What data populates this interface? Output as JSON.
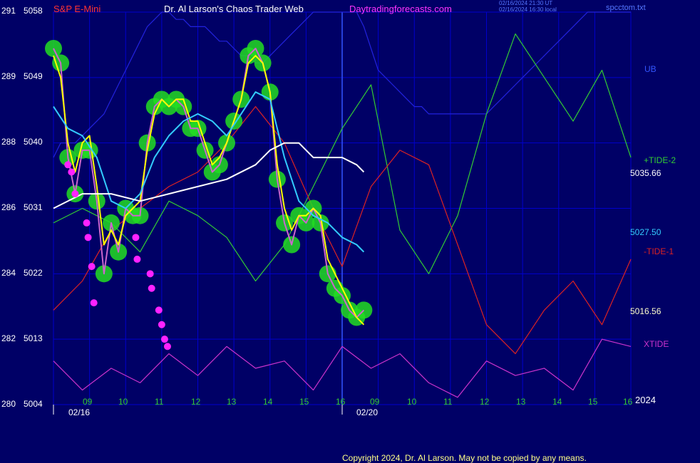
{
  "header": {
    "instrument": "S&P E-Mini",
    "site_title": "Dr. Al Larson's Chaos Trader Web",
    "site_url": "Daytradingforecasts.com",
    "timestamp_line1": "02/16/2024 21:30 UT",
    "timestamp_line2": "02/16/2024 16:30 local",
    "filename": "spcctom.txt"
  },
  "right_labels": {
    "ub": "UB",
    "tide2": "+TIDE-2",
    "value_upper": "5035.66",
    "value_mid": "5027.50",
    "tide1": "-TIDE-1",
    "value_lower": "5016.56",
    "xtide": "XTIDE",
    "year": "2024"
  },
  "footer": {
    "copyright": "Copyright 2024, Dr. Al Larson. May not be copied by any means."
  },
  "colors": {
    "background": "#000066",
    "grid": "#0000cc",
    "axis_text": "#ffffff",
    "price": "#cc66cc",
    "fast_avg": "#ffff00",
    "mid_avg": "#33ccff",
    "slow_avg": "#ffffff",
    "tide_green": "#33cc33",
    "tide_red": "#dd2222",
    "band_blue": "#2222dd",
    "xtide": "#cc33cc",
    "glow": "#22dd22",
    "marker": "#ff22ff"
  },
  "chart_data": {
    "type": "line",
    "title": "S&P E-Mini",
    "y_axis_left_ticks": [
      "291",
      "289",
      "288",
      "286",
      "284",
      "282",
      "280"
    ],
    "y_axis_price_ticks": [
      "5058",
      "5049",
      "5040",
      "5031",
      "5022",
      "5013",
      "5004"
    ],
    "ylim": [
      5004,
      5058
    ],
    "x_tick_labels": [
      "09",
      "10",
      "11",
      "12",
      "13",
      "14",
      "15",
      "16",
      "09",
      "10",
      "11",
      "12",
      "13",
      "14",
      "15",
      "16"
    ],
    "date_labels": [
      "02/16",
      "02/20"
    ],
    "series": [
      {
        "name": "UB",
        "color": "#2222dd",
        "x": [
          0,
          1,
          2,
          3,
          4,
          5,
          6,
          7,
          8,
          9,
          10,
          11,
          12,
          13,
          14,
          15,
          16,
          17,
          18,
          19,
          20,
          21,
          22,
          23,
          24,
          25,
          26,
          27,
          28,
          29,
          30,
          31,
          32,
          33,
          34,
          35,
          36,
          37,
          38,
          39,
          40,
          41,
          42,
          43,
          44,
          45,
          46,
          47,
          48,
          49,
          50,
          51,
          52,
          53,
          54,
          55,
          56,
          57,
          58,
          59,
          60,
          61,
          62,
          63,
          64,
          65,
          66,
          67,
          68,
          69,
          70,
          71,
          72,
          73,
          74,
          75,
          76,
          77,
          78,
          79,
          80
        ],
        "values": [
          5038,
          5040,
          5040,
          5040,
          5041,
          5042,
          5043,
          5044,
          5046,
          5048,
          5050,
          5052,
          5054,
          5056,
          5057,
          5058,
          5058,
          5057,
          5057,
          5056,
          5056,
          5056,
          5055,
          5054,
          5054,
          5053,
          5052,
          5052,
          5051,
          5051,
          5052,
          5053,
          5054,
          5055,
          5056,
          5057,
          5058,
          5058,
          5058,
          5058,
          5058,
          5058,
          5058,
          5056,
          5053,
          5050,
          5049,
          5048,
          5047,
          5046,
          5045,
          5045,
          5044,
          5044,
          5044,
          5044,
          5044,
          5044,
          5044,
          5044,
          5044,
          5045,
          5046,
          5047,
          5048,
          5049,
          5050,
          5051,
          5052,
          5053,
          5054,
          5055,
          5056,
          5057,
          5058,
          5058,
          5058,
          5058,
          5058,
          5058,
          5058
        ]
      },
      {
        "name": "+TIDE-2",
        "color": "#33cc33",
        "x": [
          0,
          4,
          8,
          12,
          16,
          20,
          24,
          28,
          32,
          36,
          40,
          44,
          48,
          52,
          56,
          60,
          64,
          68,
          72,
          76,
          80
        ],
        "values": [
          5029,
          5031,
          5029,
          5025,
          5032,
          5030,
          5027,
          5021,
          5026,
          5034,
          5042,
          5048,
          5028,
          5022,
          5030,
          5044,
          5055,
          5049,
          5043,
          5050,
          5038
        ]
      },
      {
        "name": "-TIDE-1",
        "color": "#dd2222",
        "x": [
          0,
          4,
          8,
          12,
          16,
          20,
          24,
          28,
          32,
          36,
          40,
          44,
          48,
          52,
          56,
          60,
          64,
          68,
          72,
          76,
          80
        ],
        "values": [
          5017,
          5021,
          5028,
          5031,
          5034,
          5036,
          5040,
          5045,
          5040,
          5031,
          5023,
          5034,
          5039,
          5037,
          5026,
          5015,
          5011,
          5017,
          5021,
          5015,
          5024
        ]
      },
      {
        "name": "XTIDE",
        "color": "#cc33cc",
        "x": [
          0,
          4,
          8,
          12,
          16,
          20,
          24,
          28,
          32,
          36,
          40,
          44,
          48,
          52,
          56,
          60,
          64,
          68,
          72,
          76,
          80
        ],
        "values": [
          5010,
          5006,
          5009,
          5007,
          5011,
          5008,
          5012,
          5009,
          5010,
          5006,
          5012,
          5009,
          5011,
          5007,
          5005,
          5010,
          5008,
          5009,
          5006,
          5013,
          5012
        ]
      },
      {
        "name": "Price",
        "color": "#cc66cc",
        "x": [
          0,
          1,
          2,
          3,
          4,
          5,
          6,
          7,
          8,
          9,
          10,
          11,
          12,
          13,
          14,
          15,
          16,
          17,
          18,
          19,
          20,
          21,
          22,
          23,
          24,
          25,
          26,
          27,
          28,
          29,
          30,
          31,
          32,
          33,
          34,
          35,
          36,
          37,
          38,
          39,
          40,
          41,
          42,
          43
        ],
        "values": [
          5053,
          5051,
          5038,
          5033,
          5039,
          5039,
          5032,
          5022,
          5029,
          5025,
          5031,
          5030,
          5030,
          5040,
          5045,
          5046,
          5045,
          5046,
          5045,
          5042,
          5042,
          5039,
          5036,
          5037,
          5040,
          5043,
          5046,
          5052,
          5053,
          5051,
          5047,
          5035,
          5029,
          5026,
          5030,
          5029,
          5031,
          5029,
          5022,
          5020,
          5019,
          5017,
          5016,
          5017
        ]
      },
      {
        "name": "Fast average",
        "color": "#ffff00",
        "x": [
          0,
          1,
          2,
          3,
          4,
          5,
          6,
          7,
          8,
          9,
          10,
          11,
          12,
          13,
          14,
          15,
          16,
          17,
          18,
          19,
          20,
          21,
          22,
          23,
          24,
          25,
          26,
          27,
          28,
          29,
          30,
          31,
          32,
          33,
          34,
          35,
          36,
          37,
          38,
          39,
          40,
          41,
          42,
          43
        ],
        "values": [
          5052,
          5049,
          5040,
          5036,
          5040,
          5041,
          5034,
          5026,
          5028,
          5026,
          5030,
          5031,
          5032,
          5039,
          5044,
          5046,
          5045,
          5046,
          5046,
          5043,
          5043,
          5040,
          5037,
          5038,
          5040,
          5043,
          5046,
          5051,
          5052,
          5051,
          5047,
          5037,
          5031,
          5028,
          5030,
          5030,
          5031,
          5030,
          5024,
          5022,
          5020,
          5018,
          5016,
          5015
        ]
      },
      {
        "name": "Mid average",
        "color": "#33ccff",
        "x": [
          0,
          2,
          4,
          6,
          8,
          10,
          12,
          14,
          16,
          18,
          20,
          22,
          24,
          26,
          28,
          30,
          32,
          34,
          36,
          38,
          40,
          42,
          43
        ],
        "values": [
          5045,
          5042,
          5041,
          5038,
          5032,
          5031,
          5033,
          5038,
          5041,
          5043,
          5044,
          5043,
          5041,
          5044,
          5047,
          5046,
          5038,
          5032,
          5030,
          5029,
          5027,
          5026,
          5025
        ]
      },
      {
        "name": "Slow average",
        "color": "#ffffff",
        "x": [
          0,
          4,
          8,
          12,
          16,
          20,
          24,
          28,
          30,
          32,
          34,
          36,
          38,
          40,
          42,
          43
        ],
        "values": [
          5031,
          5033,
          5033,
          5032,
          5033,
          5034,
          5035,
          5037,
          5039,
          5040,
          5040,
          5038,
          5038,
          5038,
          5037,
          5036
        ]
      }
    ],
    "markers": {
      "color": "#ff22ff",
      "x": [
        2,
        2.5,
        3,
        4.6,
        4.8,
        5.3,
        5.6,
        11.4,
        11.6,
        13.4,
        13.6,
        14.6,
        15.0,
        15.4,
        15.8
      ],
      "values": [
        5037,
        5036,
        5033,
        5029,
        5027,
        5023,
        5018,
        5027,
        5024,
        5022,
        5020,
        5017,
        5015,
        5013,
        5012
      ]
    }
  }
}
